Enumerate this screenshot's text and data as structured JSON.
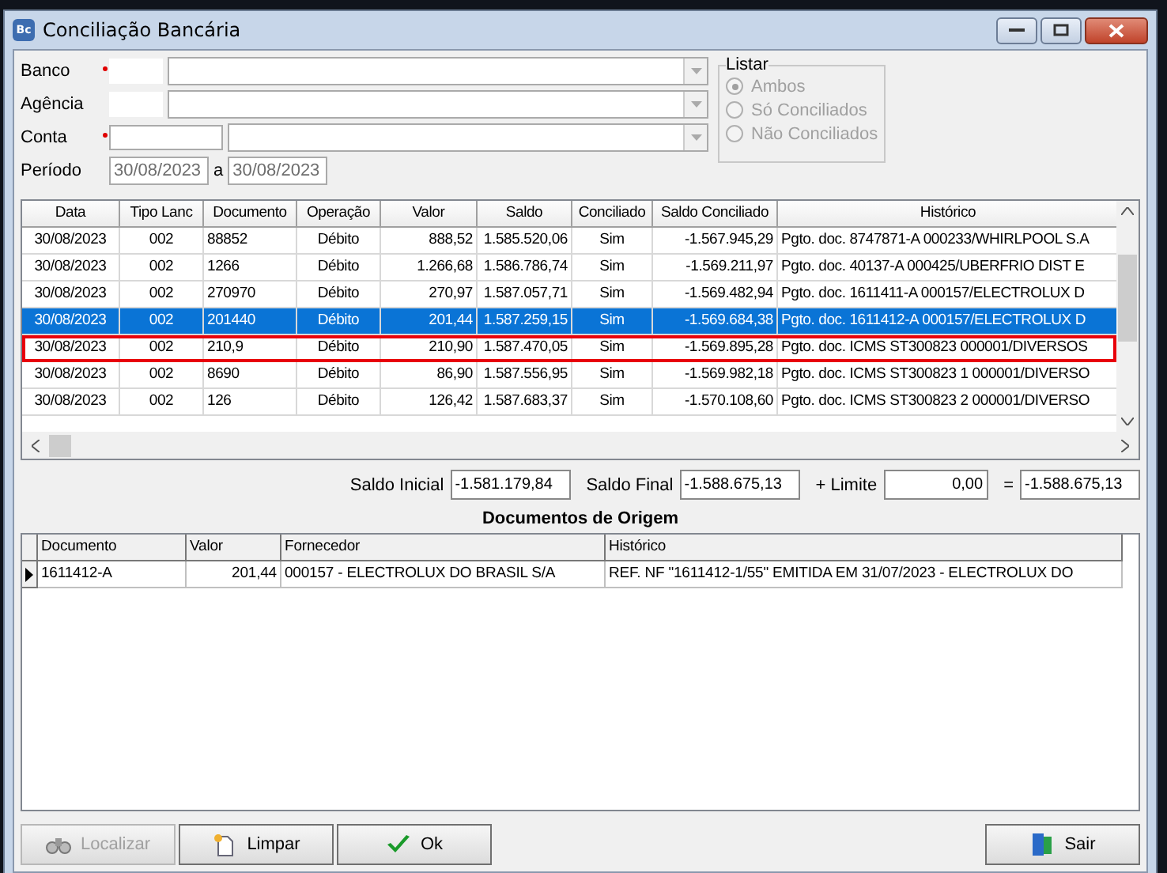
{
  "window": {
    "title": "Conciliação Bancária",
    "app_icon": "Bc"
  },
  "form": {
    "fields": [
      {
        "label": "Banco",
        "required": true,
        "has_dropdown": true
      },
      {
        "label": "Agência",
        "required": false,
        "has_dropdown": true
      },
      {
        "label": "Conta",
        "required": true,
        "has_dropdown": true
      }
    ],
    "period": {
      "label": "Período",
      "from": "30/08/2023",
      "separator": "a",
      "to": "30/08/2023"
    },
    "listar": {
      "title": "Listar",
      "disabled": true,
      "options": [
        {
          "label": "Ambos",
          "selected": true
        },
        {
          "label": "Só Conciliados",
          "selected": false
        },
        {
          "label": "Não Conciliados",
          "selected": false
        }
      ]
    }
  },
  "table": {
    "columns": [
      "Data",
      "Tipo Lanc",
      "Documento",
      "Operação",
      "Valor",
      "Saldo",
      "Conciliado",
      "Saldo Conciliado",
      "Histórico"
    ],
    "rows": [
      {
        "cells": [
          "30/08/2023",
          "002",
          "88852",
          "Débito",
          "888,52",
          "1.585.520,06",
          "Sim",
          "-1.567.945,29",
          "Pgto. doc. 8747871-A 000233/WHIRLPOOL S.A"
        ],
        "selected": false,
        "highlighted": false
      },
      {
        "cells": [
          "30/08/2023",
          "002",
          "1266",
          "Débito",
          "1.266,68",
          "1.586.786,74",
          "Sim",
          "-1.569.211,97",
          "Pgto. doc. 40137-A 000425/UBERFRIO DIST E"
        ],
        "selected": false,
        "highlighted": false
      },
      {
        "cells": [
          "30/08/2023",
          "002",
          "270970",
          "Débito",
          "270,97",
          "1.587.057,71",
          "Sim",
          "-1.569.482,94",
          "Pgto. doc. 1611411-A 000157/ELECTROLUX D"
        ],
        "selected": false,
        "highlighted": false
      },
      {
        "cells": [
          "30/08/2023",
          "002",
          "201440",
          "Débito",
          "201,44",
          "1.587.259,15",
          "Sim",
          "-1.569.684,38",
          "Pgto. doc. 1611412-A 000157/ELECTROLUX D"
        ],
        "selected": true,
        "highlighted": false
      },
      {
        "cells": [
          "30/08/2023",
          "002",
          "210,9",
          "Débito",
          "210,90",
          "1.587.470,05",
          "Sim",
          "-1.569.895,28",
          "Pgto. doc. ICMS ST300823 000001/DIVERSOS"
        ],
        "selected": false,
        "highlighted": true
      },
      {
        "cells": [
          "30/08/2023",
          "002",
          "8690",
          "Débito",
          "86,90",
          "1.587.556,95",
          "Sim",
          "-1.569.982,18",
          "Pgto. doc. ICMS ST300823 1 000001/DIVERSO"
        ],
        "selected": false,
        "highlighted": false
      },
      {
        "cells": [
          "30/08/2023",
          "002",
          "126",
          "Débito",
          "126,42",
          "1.587.683,37",
          "Sim",
          "-1.570.108,60",
          "Pgto. doc. ICMS ST300823 2 000001/DIVERSO"
        ],
        "selected": false,
        "highlighted": false
      }
    ]
  },
  "totals": [
    {
      "label": "Saldo Inicial",
      "value": "-1.581.179,84"
    },
    {
      "label": "Saldo Final",
      "value": "-1.588.675,13"
    },
    {
      "label": "+ Limite",
      "value": "0,00"
    },
    {
      "label": "=",
      "value": "-1.588.675,13"
    }
  ],
  "origin": {
    "title": "Documentos de Origem",
    "columns": [
      "Documento",
      "Valor",
      "Fornecedor",
      "Histórico"
    ],
    "rows": [
      {
        "cells": [
          "1611412-A",
          "201,44",
          "000157 - ELECTROLUX DO BRASIL S/A",
          "REF. NF \"1611412-1/55\" EMITIDA EM 31/07/2023 - ELECTROLUX DO"
        ],
        "current": true
      }
    ]
  },
  "buttons": [
    {
      "label": "Localizar",
      "kind": "find",
      "disabled": true
    },
    {
      "label": "Limpar",
      "kind": "clear",
      "disabled": false
    },
    {
      "label": "Ok",
      "kind": "ok",
      "disabled": false
    },
    {
      "label": "Sair",
      "kind": "exit",
      "disabled": false
    }
  ]
}
